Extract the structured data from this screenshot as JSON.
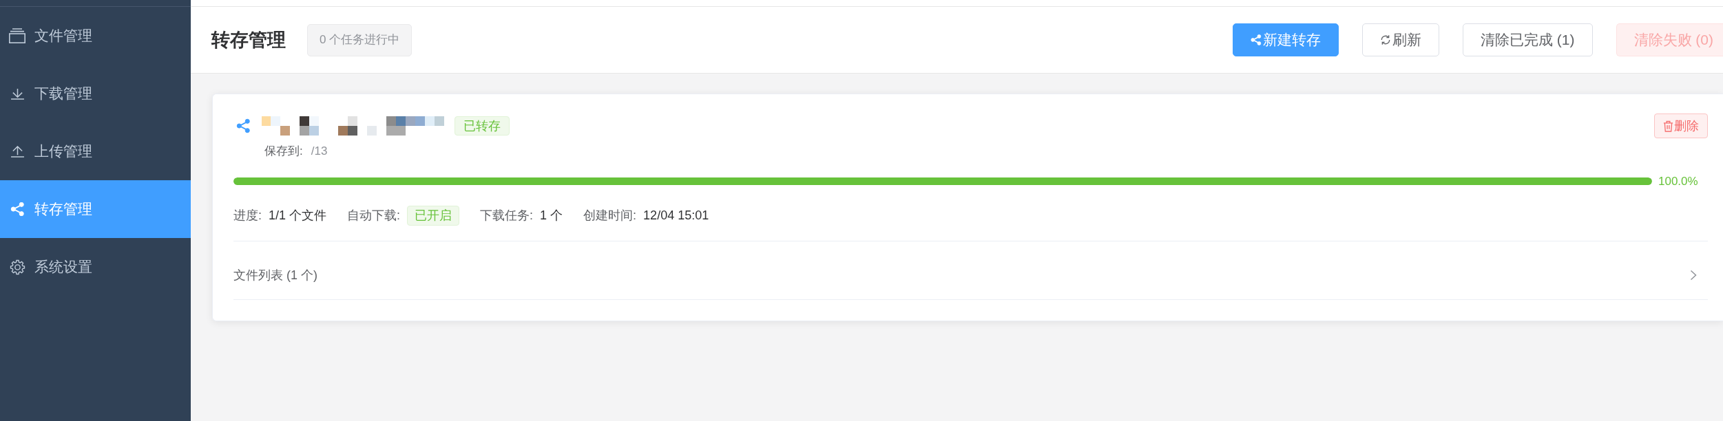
{
  "sidebar": {
    "items": [
      {
        "label": "文件管理",
        "selected": false
      },
      {
        "label": "下载管理",
        "selected": false
      },
      {
        "label": "上传管理",
        "selected": false
      },
      {
        "label": "转存管理",
        "selected": true
      },
      {
        "label": "系统设置",
        "selected": false
      }
    ]
  },
  "header": {
    "title": "转存管理",
    "task_count": "0 个任务进行中",
    "buttons": [
      {
        "label": "新建转存",
        "kind": "primary",
        "disabled": false
      },
      {
        "label": "刷新",
        "kind": "refresh",
        "disabled": false
      },
      {
        "label": "清除已完成 (1)",
        "kind": "plain",
        "disabled": false
      },
      {
        "label": "清除失败 (0)",
        "kind": "danger",
        "disabled": true
      }
    ]
  },
  "tasks": [
    {
      "status": {
        "text": "已转存",
        "kind": "success"
      },
      "delete_button": "删除",
      "save_label": "保存到:",
      "save_path": "/13",
      "level": 1,
      "percent": "100.0%",
      "meta": [
        {
          "label": "进度:",
          "value": "1/1 个文件",
          "kind": "text"
        },
        {
          "label": "自动下载:",
          "value": "已开启",
          "kind": "tag"
        },
        {
          "label": "下载任务:",
          "value": "1 个",
          "kind": "text"
        },
        {
          "label": "创建时间:",
          "value": "12/04 15:01",
          "kind": "text"
        }
      ],
      "file_list": {
        "title": "文件列表 (1 个)",
        "expanded": false
      }
    }
  ]
}
